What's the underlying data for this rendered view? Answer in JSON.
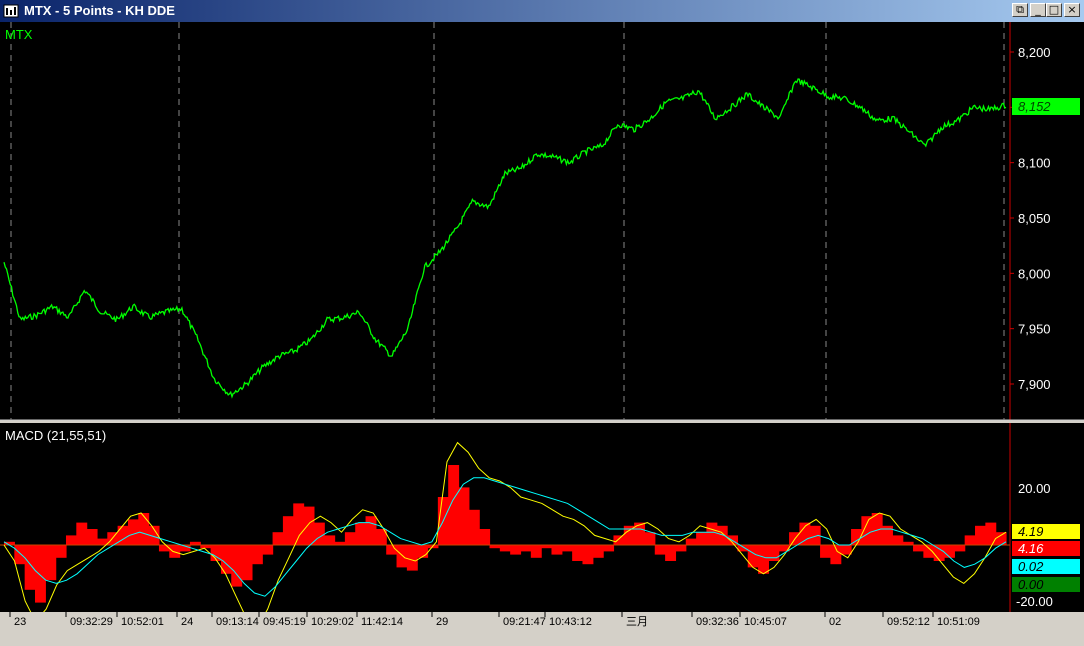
{
  "window": {
    "title": "MTX - 5 Points - KH DDE",
    "buttons": [
      "restore-icon",
      "minimize-icon",
      "maximize-icon",
      "close-icon"
    ]
  },
  "colors": {
    "background": "#000000",
    "price_line": "#00ff00",
    "macd_hist": "#ff0000",
    "macd_line": "#ffff00",
    "signal_line": "#00ffff",
    "axis_border": "#cc0000",
    "label_green": "#00ff00",
    "label_yellow": "#ffff00",
    "label_red": "#ff0000",
    "label_cyan": "#00ffff",
    "label_darkgreen": "#008000"
  },
  "price_panel": {
    "symbol": "MTX",
    "y_ticks": [
      "8,200",
      "8,150",
      "8,100",
      "8,050",
      "8,000",
      "7,950",
      "7,900"
    ],
    "current_label": "8,152"
  },
  "macd_panel": {
    "title": "MACD  (21,55,51)",
    "y_ticks": [
      "20.00",
      "-20.00"
    ],
    "labels": {
      "macd": "4.19",
      "diff": "4.16",
      "signal": "0.02",
      "zero": "0.00"
    }
  },
  "x_axis": {
    "labels": [
      "23",
      "09:32:29",
      "10:52:01",
      "24",
      "09:13:14",
      "09:45:19",
      "10:29:02",
      "11:42:14",
      "29",
      "09:21:47",
      "10:43:12",
      "三月",
      "09:32:36",
      "10:45:07",
      "02",
      "09:52:12",
      "10:51:09"
    ]
  },
  "chart_data": {
    "type": "line",
    "title": "MTX",
    "series": [
      {
        "name": "MTX",
        "x_sessions": [
          "23",
          "24",
          "29",
          "三月",
          "02"
        ],
        "values": [
          8010,
          7958,
          7962,
          7970,
          7960,
          7985,
          7965,
          7958,
          7970,
          7960,
          7965,
          7968,
          7940,
          7905,
          7890,
          7900,
          7915,
          7925,
          7930,
          7940,
          7958,
          7960,
          7965,
          7940,
          7925,
          7950,
          8005,
          8020,
          8040,
          8065,
          8060,
          8090,
          8095,
          8108,
          8105,
          8100,
          8110,
          8115,
          8135,
          8130,
          8140,
          8155,
          8158,
          8165,
          8140,
          8150,
          8162,
          8150,
          8140,
          8175,
          8168,
          8160,
          8158,
          8150,
          8138,
          8140,
          8128,
          8115,
          8132,
          8138,
          8150,
          8148,
          8152
        ]
      }
    ],
    "ylim": [
      7875,
      8225
    ]
  }
}
